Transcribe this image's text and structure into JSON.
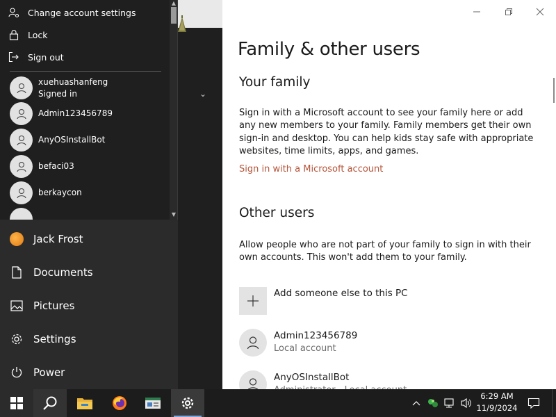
{
  "account_menu": {
    "change_settings": "Change account settings",
    "lock": "Lock",
    "sign_out": "Sign out",
    "accounts": [
      {
        "name": "xuehuashanfeng",
        "status": "Signed in"
      },
      {
        "name": "Admin123456789",
        "status": ""
      },
      {
        "name": "AnyOSInstallBot",
        "status": ""
      },
      {
        "name": "befaci03",
        "status": ""
      },
      {
        "name": "berkaycon",
        "status": ""
      }
    ]
  },
  "start_nav": {
    "user": "Jack Frost",
    "documents": "Documents",
    "pictures": "Pictures",
    "settings": "Settings",
    "power": "Power"
  },
  "settings": {
    "title": "Family & other users",
    "your_family_heading": "Your family",
    "your_family_text": "Sign in with a Microsoft account to see your family here or add any new members to your family. Family members get their own sign-in and desktop. You can help kids stay safe with appropriate websites, time limits, apps, and games.",
    "ms_link": "Sign in with a Microsoft account",
    "other_users_heading": "Other users",
    "other_users_text": "Allow people who are not part of your family to sign in with their own accounts. This won't add them to your family.",
    "add_someone": "Add someone else to this PC",
    "users": [
      {
        "name": "Admin123456789",
        "type": "Local account"
      },
      {
        "name": "AnyOSInstallBot",
        "type": "Administrator - Local account"
      }
    ]
  },
  "taskbar": {
    "time": "6:29 AM",
    "date": "11/9/2024"
  },
  "colors": {
    "link": "#b5553a",
    "start_bg": "#2b2b2b",
    "flyout_bg": "#1f1f1f",
    "taskbar_bg": "#1c1c1c"
  }
}
